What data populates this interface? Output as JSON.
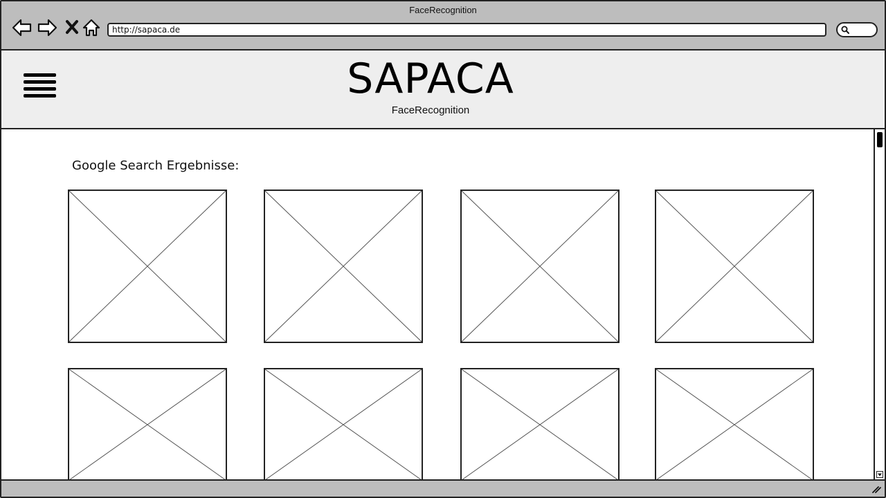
{
  "window": {
    "title": "FaceRecognition"
  },
  "toolbar": {
    "back_icon": "arrow-left-icon",
    "forward_icon": "arrow-right-icon",
    "stop_icon": "close-icon",
    "home_icon": "home-icon",
    "url": "http://sapaca.de",
    "search_icon": "search-icon"
  },
  "header": {
    "menu_icon": "hamburger-menu-icon",
    "brand": "SAPACA",
    "subtitle": "FaceRecognition"
  },
  "main": {
    "section_title": "Google Search Ergebnisse:",
    "results": [
      {
        "row": 1,
        "col": 1
      },
      {
        "row": 1,
        "col": 2
      },
      {
        "row": 1,
        "col": 3
      },
      {
        "row": 1,
        "col": 4
      },
      {
        "row": 2,
        "col": 1
      },
      {
        "row": 2,
        "col": 2
      },
      {
        "row": 2,
        "col": 3
      },
      {
        "row": 2,
        "col": 4
      }
    ]
  },
  "colors": {
    "chrome": "#bdbdbd",
    "header_bg": "#eeeeee",
    "stroke": "#222222"
  }
}
